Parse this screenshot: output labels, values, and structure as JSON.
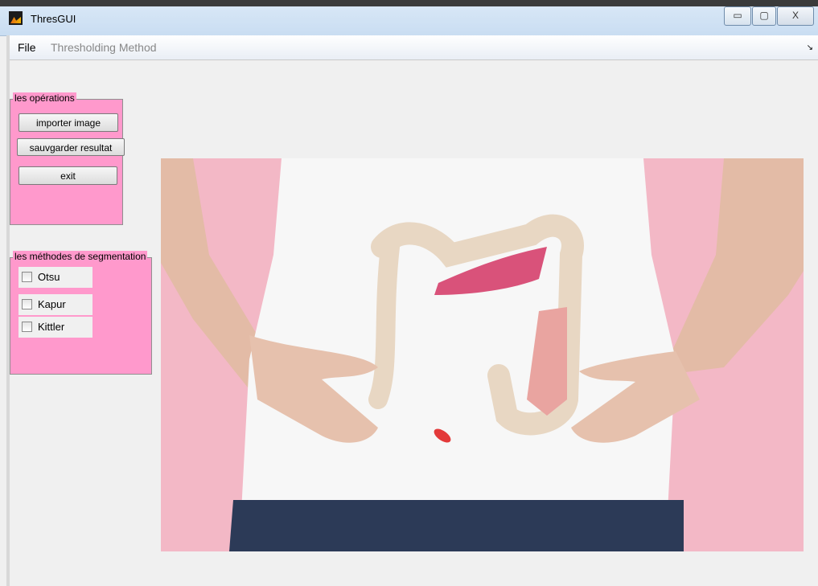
{
  "window": {
    "title": "ThresGUI",
    "controls": {
      "minimize": "▭",
      "maximize": "▢",
      "close": "X"
    }
  },
  "menu": {
    "file": "File",
    "thresholding": "Thresholding Method",
    "corner": "↘"
  },
  "operations_panel": {
    "title": "les opérations",
    "import_button": "importer image",
    "save_button": "sauvgarder resultat",
    "exit_button": "exit"
  },
  "segmentation_panel": {
    "title": "les méthodes de segmentation",
    "methods": [
      {
        "label": "Otsu",
        "checked": false
      },
      {
        "label": "Kapur",
        "checked": false
      },
      {
        "label": "Kittler",
        "checked": false
      }
    ]
  },
  "colors": {
    "panel_pink": "#ff99cc",
    "photo_background": "#f3b8c6",
    "shirt": "#f7f7f7",
    "skin": "#e3bba6",
    "denim": "#2c3a57"
  }
}
